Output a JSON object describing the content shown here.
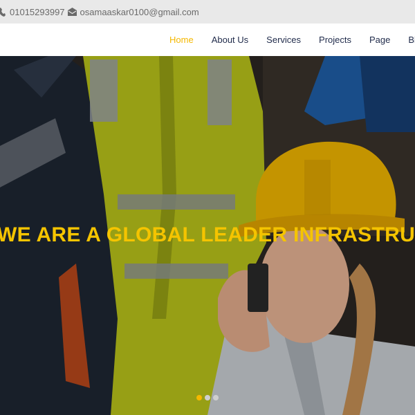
{
  "topbar": {
    "phone": "01015293997",
    "email": "osamaaskar0100@gmail.com",
    "phone_icon": "phone-icon",
    "email_icon": "envelope-icon"
  },
  "nav": {
    "items": [
      {
        "label": "Home",
        "active": true
      },
      {
        "label": "About Us",
        "active": false
      },
      {
        "label": "Services",
        "active": false
      },
      {
        "label": "Projects",
        "active": false
      },
      {
        "label": "Page",
        "active": false
      },
      {
        "label": "Blog",
        "active": false
      }
    ],
    "active_color": "#f5b800"
  },
  "hero": {
    "headline": "WE ARE A GLOBAL LEADER INFRASTRUCTURE",
    "headline_color": "#f5c400",
    "slider": {
      "count": 3,
      "active": 0
    }
  }
}
